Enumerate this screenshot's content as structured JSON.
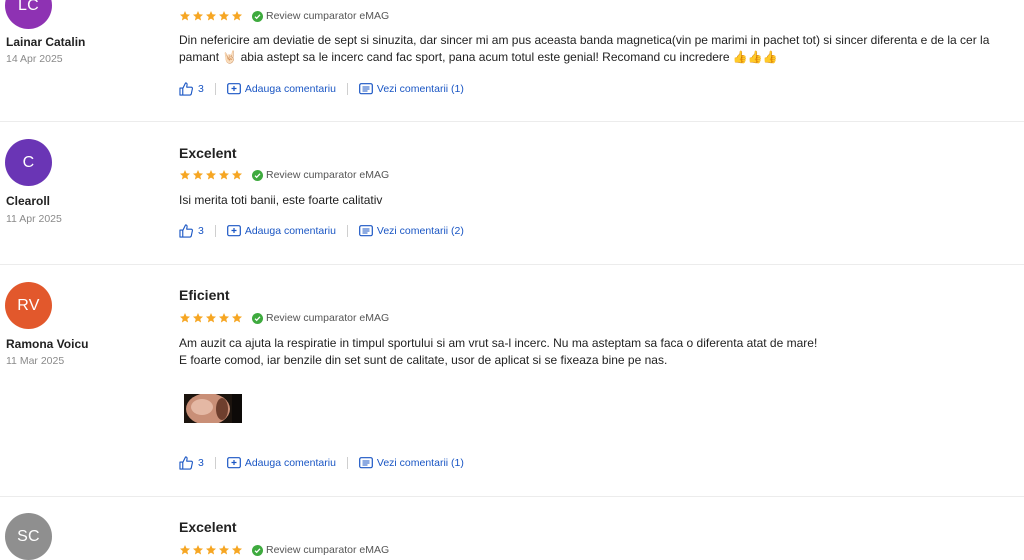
{
  "colors": {
    "star": "#f6a623",
    "verified": "#3eaa3e",
    "link": "#1a56c4"
  },
  "reviews": [
    {
      "initials": "LC",
      "avatar_color": "#8e32b3",
      "author": "Lainar Catalin",
      "date": "14 Apr 2025",
      "title": "",
      "rating": 5,
      "badge": "Review cumparator eMAG",
      "body": [
        "Din nefericire am deviatie de sept si sinuzita, dar sincer mi am pus aceasta banda magnetica(vin pe marimi in pachet tot) si sincer diferenta e de la cer la",
        "pamant 🤘🏻 abia astept sa le incerc cand fac sport, pana acum totul este genial! Recomand cu incredere 👍👍👍"
      ],
      "likes": "3",
      "add_comment": "Adauga comentariu",
      "view_comments": "Vezi comentarii (1)"
    },
    {
      "initials": "C",
      "avatar_color": "#6a35b5",
      "author": "Clearoll",
      "date": "11 Apr 2025",
      "title": "Excelent",
      "rating": 5,
      "badge": "Review cumparator eMAG",
      "body": [
        "Isi merita toti banii, este foarte calitativ"
      ],
      "likes": "3",
      "add_comment": "Adauga comentariu",
      "view_comments": "Vezi comentarii (2)"
    },
    {
      "initials": "RV",
      "avatar_color": "#e2582c",
      "author": "Ramona Voicu",
      "date": "11 Mar 2025",
      "title": "Eficient",
      "rating": 5,
      "badge": "Review cumparator eMAG",
      "body": [
        "Am auzit ca ajuta la respiratie in timpul sportului si am vrut sa-l incerc. Nu ma asteptam sa faca o diferenta atat de mare!",
        "E foarte comod, iar benzile din set sunt de calitate, usor de aplicat si se fixeaza bine pe nas."
      ],
      "likes": "3",
      "add_comment": "Adauga comentariu",
      "view_comments": "Vezi comentarii (1)"
    },
    {
      "initials": "SC",
      "avatar_color": "#8f8f8f",
      "author": "",
      "date": "",
      "title": "Excelent",
      "rating": 5,
      "badge": "Review cumparator eMAG",
      "body": []
    }
  ]
}
